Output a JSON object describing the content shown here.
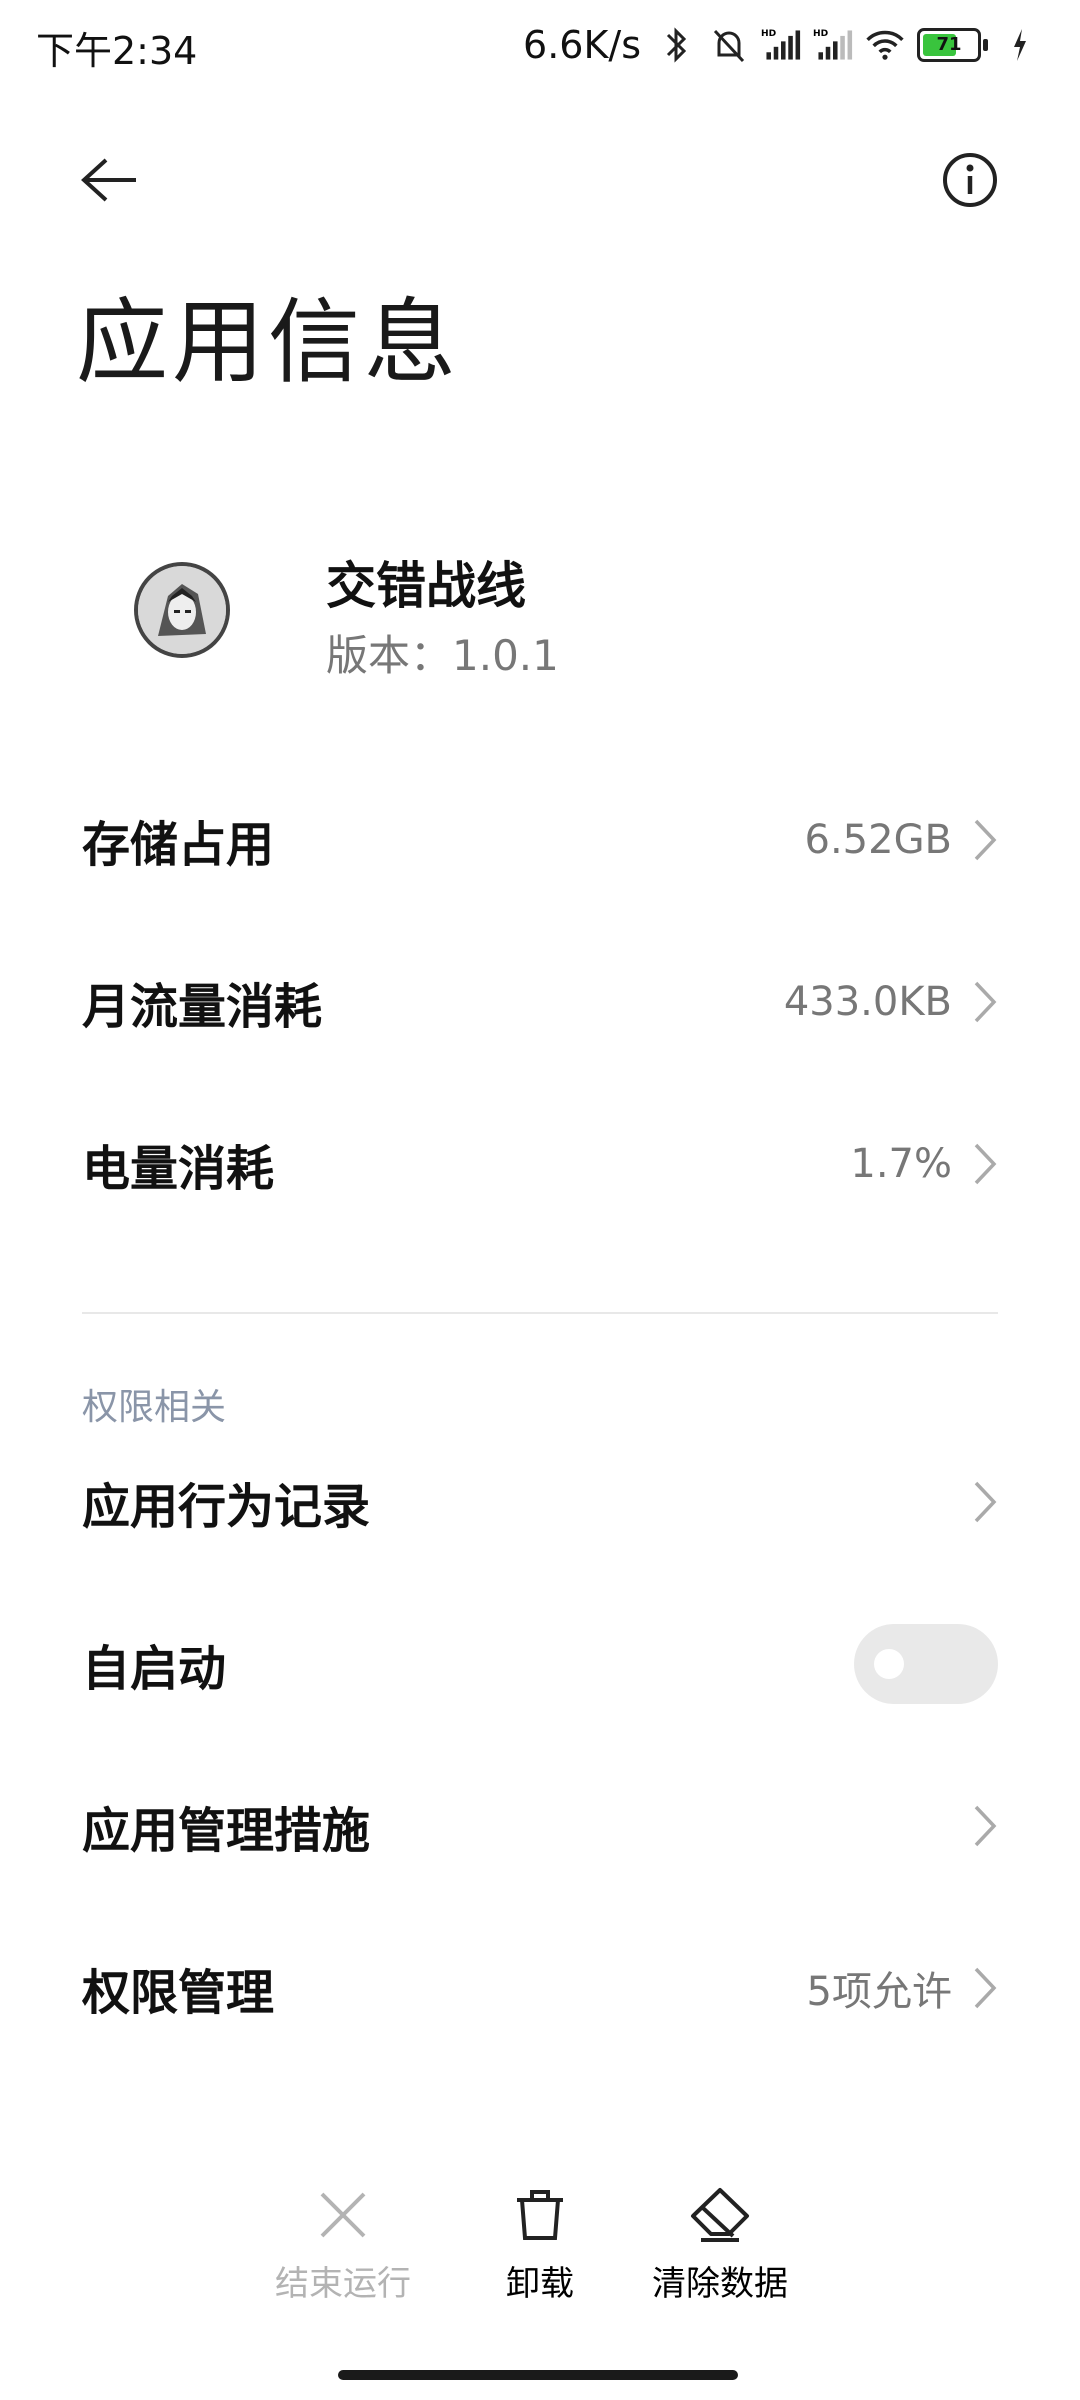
{
  "status": {
    "time": "下午2:34",
    "net_speed": "6.6K/s",
    "battery": "71",
    "battery_level": 0.71,
    "icons": [
      "bluetooth-icon",
      "silent-bell-icon",
      "hd-signal-icon",
      "hd-signal-icon",
      "wifi-icon",
      "battery-icon",
      "charging-icon"
    ]
  },
  "header": {
    "title": "应用信息",
    "back_icon": "arrow-left-icon",
    "info_icon": "info-icon"
  },
  "app": {
    "name": "交错战线",
    "version": "版本：1.0.1"
  },
  "usage": [
    {
      "label": "存储占用",
      "value": "6.52GB"
    },
    {
      "label": "月流量消耗",
      "value": "433.0KB"
    },
    {
      "label": "电量消耗",
      "value": "1.7%"
    }
  ],
  "permissions": {
    "section_title": "权限相关",
    "behavior_log": "应用行为记录",
    "autostart": {
      "label": "自启动",
      "enabled": false
    },
    "management_measures": "应用管理措施",
    "permission_mgmt": {
      "label": "权限管理",
      "value": "5项允许"
    }
  },
  "bottom": {
    "stop": "结束运行",
    "uninstall": "卸载",
    "clear": "清除数据"
  }
}
